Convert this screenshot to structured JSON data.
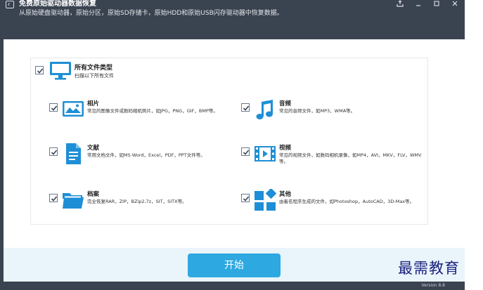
{
  "window": {
    "title": "免费原始驱动器数据恢复",
    "subtitle": "从原始硬盘驱动器，原始分区，原始SD存储卡，原始HDD和原始USB闪存驱动器中恢复数据。",
    "controls": [
      "upload-icon",
      "minimize-icon",
      "maximize-icon",
      "close-icon"
    ]
  },
  "all_types": {
    "checked": true,
    "icon": "monitor-icon",
    "title": "所有文件类型",
    "desc": "扫描以下所有文件"
  },
  "categories": [
    {
      "checked": true,
      "icon": "photo-icon",
      "title": "相片",
      "desc": "常见的图像文件或数码相机照片，如JPG，PNG，GIF，BMP等。"
    },
    {
      "checked": true,
      "icon": "music-icon",
      "title": "音频",
      "desc": "常见的音频文件，如MP3，WMA等。"
    },
    {
      "checked": true,
      "icon": "document-icon",
      "title": "文献",
      "desc": "常用文档文件，如MS Word，Excel，PDF，PPT文件等。"
    },
    {
      "checked": true,
      "icon": "video-icon",
      "title": "视频",
      "desc": "常见的视频文件，如数码相机录像，如MP4，AVI，MKV，FLV，WMV等。"
    },
    {
      "checked": true,
      "icon": "folder-icon",
      "title": "档案",
      "desc": "完全恢复RAR，ZIP，BZip2,7z，SIT，SITX等。"
    },
    {
      "checked": true,
      "icon": "other-apps-icon",
      "title": "其他",
      "desc": "由着名程序生成的文件，如Photoshop，AutoCAD，3D-Max等。"
    }
  ],
  "footer": {
    "start_label": "开始",
    "version": "Version 8.8"
  },
  "watermark": "最需教育",
  "colors": {
    "titlebar": "#3a4350",
    "icon_blue": "#1e8fd6",
    "button": "#2ea8e0",
    "footer_bg": "#eaf4fb"
  }
}
